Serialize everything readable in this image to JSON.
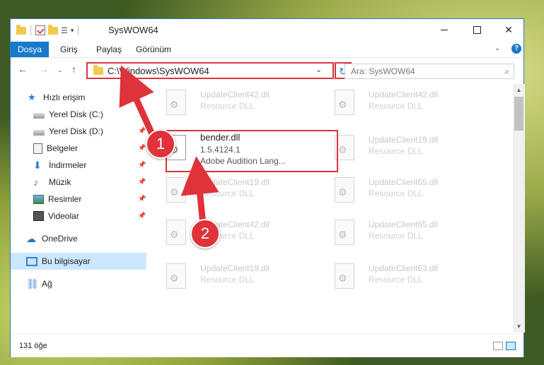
{
  "window": {
    "title": "SysWOW64"
  },
  "ribbon": {
    "tabs": [
      "Dosya",
      "Giriş",
      "Paylaş",
      "Görünüm"
    ],
    "help": "?"
  },
  "address": {
    "path": "C:\\Windows\\SysWOW64",
    "search_placeholder": "Ara: SysWOW64"
  },
  "sidebar": {
    "items": [
      {
        "label": "Hızlı erişim"
      },
      {
        "label": "Yerel Disk (C:)"
      },
      {
        "label": "Yerel Disk (D:)"
      },
      {
        "label": "Belgeler"
      },
      {
        "label": "İndirmeler"
      },
      {
        "label": "Müzik"
      },
      {
        "label": "Resimler"
      },
      {
        "label": "Videolar"
      },
      {
        "label": "OneDrive"
      },
      {
        "label": "Bu bilgisayar"
      },
      {
        "label": "Ağ"
      }
    ]
  },
  "files": [
    {
      "name": "UpdateClient42.dll",
      "type": "Resource DLL"
    },
    {
      "name": "UpdateClient42.dll",
      "type": "Resource DLL"
    },
    {
      "name": "bender.dll",
      "version": "1.5.4124.1",
      "description": "Adobe Audition Lang..."
    },
    {
      "name": "UpdateClient19.dll",
      "type": "Resource DLL"
    },
    {
      "name": "UpdateClient19.dll",
      "type": "Resource DLL"
    },
    {
      "name": "UpdateClient65.dll",
      "type": "Resource DLL"
    },
    {
      "name": "UpdateClient42.dll",
      "type": "Resource DLL"
    },
    {
      "name": "UpdateClient65.dll",
      "type": "Resource DLL"
    },
    {
      "name": "UpdateClient19.dll",
      "type": "Resource DLL"
    },
    {
      "name": "UpdateClient63.dll",
      "type": "Resource DLL"
    }
  ],
  "status": {
    "count": "131 öğe"
  },
  "annotations": {
    "step1": "1",
    "step2": "2",
    "color": "#e0323a"
  }
}
